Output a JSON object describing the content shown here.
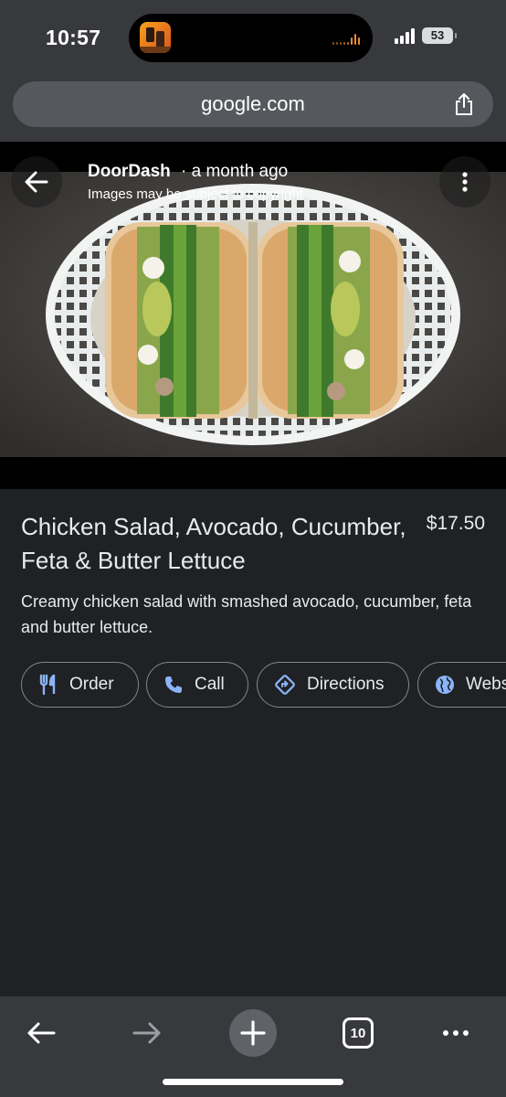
{
  "status_bar": {
    "time": "10:57",
    "battery": "53",
    "icons": [
      "app-activity-icon",
      "audio-level-icon",
      "cellular-signal-icon",
      "battery-icon"
    ]
  },
  "browser": {
    "url": "google.com",
    "share_icon": "share-icon"
  },
  "image_viewer": {
    "source": "DoorDash",
    "separator_time": "· a month ago",
    "copyright_notice": "Images may be subject to copyright",
    "back_icon": "arrow-left-icon",
    "more_icon": "more-vertical-icon"
  },
  "item": {
    "title": "Chicken Salad, Avocado, Cucumber, Feta & Butter Lettuce",
    "price": "$17.50",
    "description": "Creamy chicken salad with smashed avocado, cucumber, feta and butter lettuce."
  },
  "actions": [
    {
      "label": "Order",
      "icon": "restaurant-icon"
    },
    {
      "label": "Call",
      "icon": "phone-icon"
    },
    {
      "label": "Directions",
      "icon": "directions-icon"
    },
    {
      "label": "Website",
      "icon": "globe-icon"
    }
  ],
  "toolbar": {
    "back_icon": "arrow-left-icon",
    "forward_icon": "arrow-right-icon",
    "new_tab_icon": "plus-icon",
    "tab_count": "10",
    "more_icon": "more-horizontal-icon"
  },
  "colors": {
    "background": "#202124",
    "chrome": "#37393c",
    "accent_blue": "#8ab4f8",
    "text": "#e8eaed"
  }
}
